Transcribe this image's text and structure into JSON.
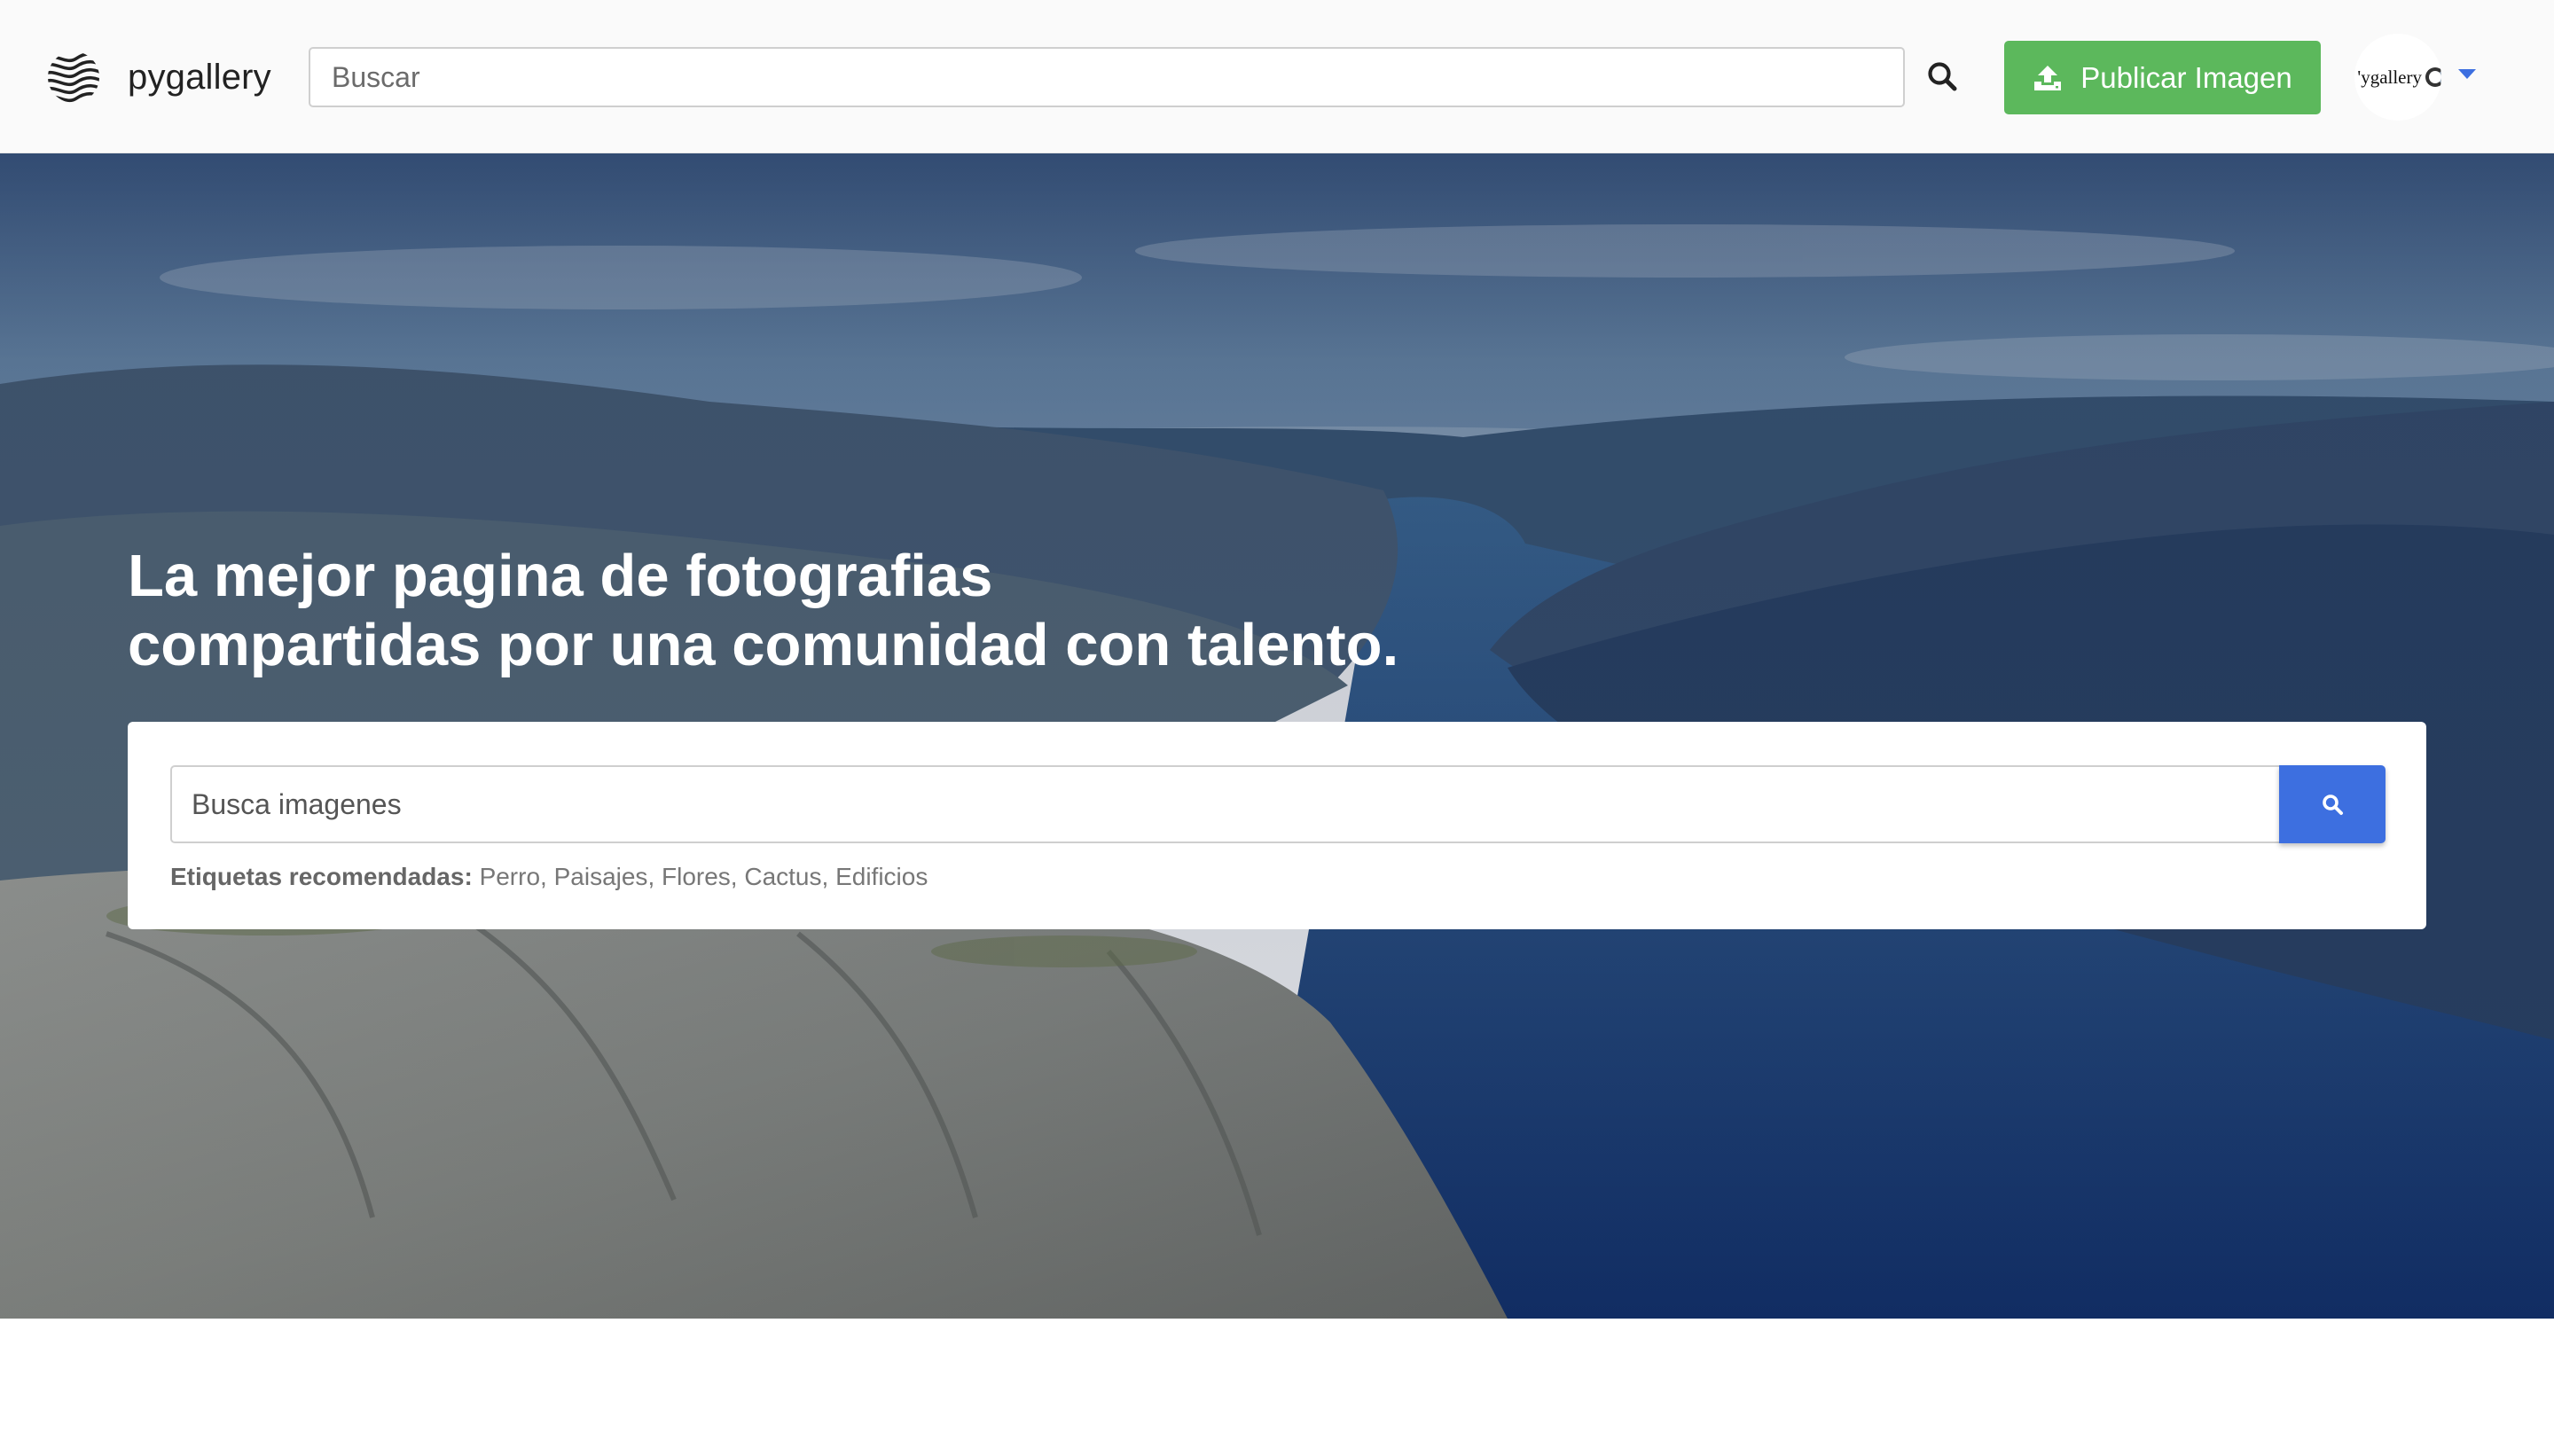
{
  "navbar": {
    "brand_name": "pygallery",
    "search_placeholder": "Buscar",
    "publish_label": "Publicar Imagen",
    "avatar_text": "'ygallery",
    "accent_color": "#5cb85c"
  },
  "hero": {
    "title_line1": "La mejor pagina de fotografias",
    "title_line2": "compartidas por una comunidad con talento.",
    "search_placeholder": "Busca imagenes",
    "tags_label": "Etiquetas recomendadas:",
    "tags": [
      "Perro",
      "Paisajes",
      "Flores",
      "Cactus",
      "Edificios"
    ],
    "search_button_color": "#3d6fe0"
  },
  "icons": {
    "logo": "wave-lines-icon",
    "nav_search": "search-icon",
    "publish": "upload-icon",
    "avatar_menu": "caret-down-icon",
    "card_search": "search-icon"
  }
}
